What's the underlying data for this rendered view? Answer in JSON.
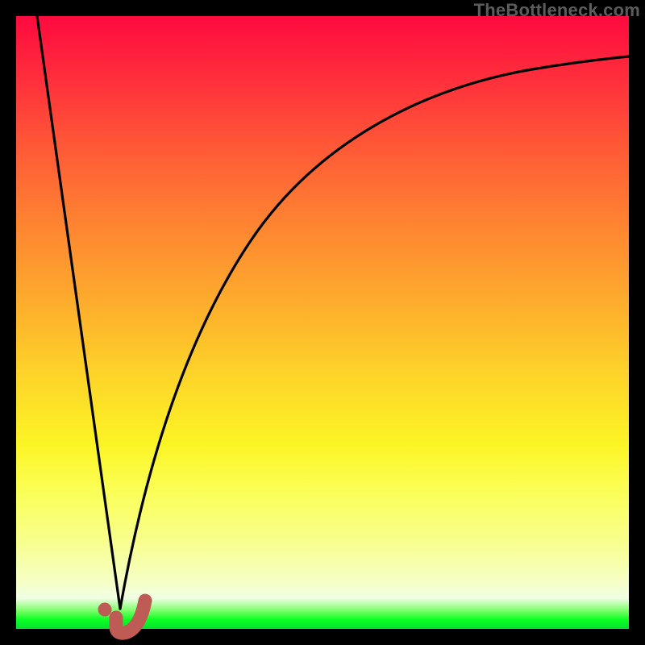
{
  "watermark": "TheBottleneck.com",
  "colors": {
    "frame": "#000000",
    "gradient_top": "#FF0A3E",
    "gradient_mid": "#FDD229",
    "gradient_bottom": "#04E12E",
    "curve": "#000000",
    "marker": "#BE5B54"
  },
  "chart_data": {
    "type": "line",
    "title": "",
    "xlabel": "",
    "ylabel": "",
    "xlim": [
      0,
      100
    ],
    "ylim": [
      0,
      100
    ],
    "series": [
      {
        "name": "left-slope",
        "x": [
          3.5,
          17
        ],
        "y": [
          100,
          3
        ]
      },
      {
        "name": "right-curve",
        "x": [
          17,
          20,
          25,
          30,
          36,
          44,
          54,
          66,
          80,
          100
        ],
        "y": [
          3,
          21,
          42,
          55,
          65,
          74,
          81,
          86,
          89,
          92
        ]
      }
    ],
    "markers": [
      {
        "name": "j-dot",
        "x": 14.5,
        "y": 3.2
      },
      {
        "name": "j-hook",
        "path_x": [
          16.3,
          16.3,
          17.1,
          18.4,
          20.0,
          21.0
        ],
        "path_y": [
          1.8,
          0.4,
          -0.2,
          -0.2,
          1.2,
          4.6
        ]
      }
    ]
  }
}
